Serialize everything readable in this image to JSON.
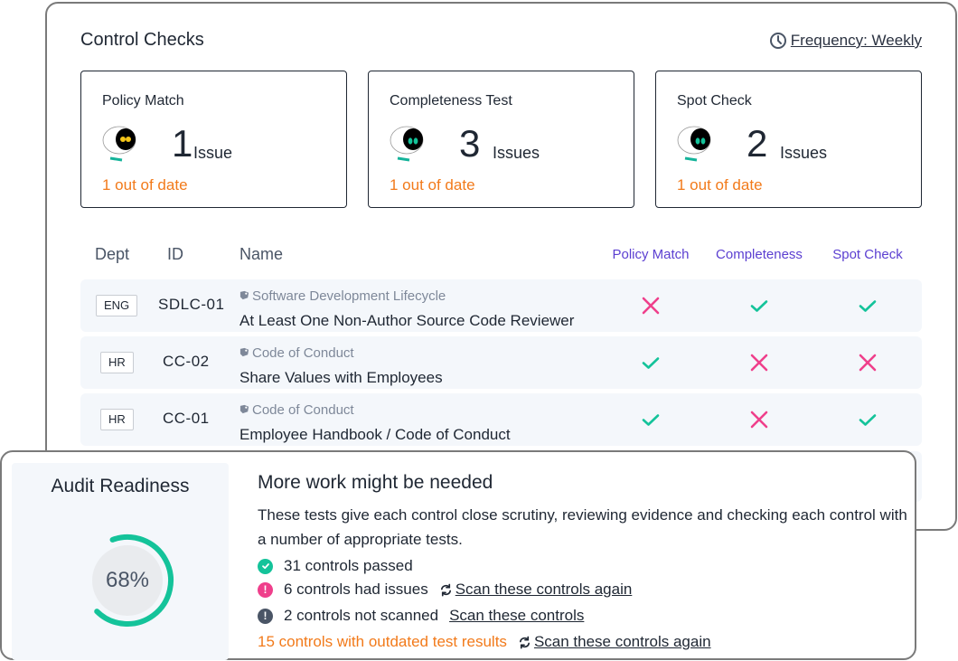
{
  "colors": {
    "accent_purple": "#5b3fd1",
    "pass_green": "#14c39a",
    "fail_pink": "#ef3f8b",
    "warn_orange": "#f27a1a",
    "neutral_slate": "#4a5566"
  },
  "control_checks": {
    "title": "Control Checks",
    "frequency": {
      "icon": "clock-icon",
      "label": "Frequency: Weekly"
    },
    "cards": [
      {
        "title": "Policy Match",
        "count": "1",
        "unit": "Issue",
        "out_of_date": "1 out of date",
        "eye_color": "yellow"
      },
      {
        "title": "Completeness Test",
        "count": "3",
        "unit": "Issues",
        "out_of_date": "1 out of date",
        "eye_color": "teal"
      },
      {
        "title": "Spot Check",
        "count": "2",
        "unit": "Issues",
        "out_of_date": "1 out of date",
        "eye_color": "teal"
      }
    ],
    "table": {
      "headers": {
        "dept": "Dept",
        "id": "ID",
        "name": "Name",
        "policy": "Policy Match",
        "completeness": "Completeness",
        "spot": "Spot Check"
      },
      "rows": [
        {
          "dept": "ENG",
          "id": "SDLC-01",
          "category": "Software Development Lifecycle",
          "name": "At Least One Non-Author Source Code Reviewer",
          "policy": "fail",
          "completeness": "pass",
          "spot": "pass"
        },
        {
          "dept": "HR",
          "id": "CC-02",
          "category": "Code of Conduct",
          "name": "Share Values with Employees",
          "policy": "pass",
          "completeness": "fail",
          "spot": "fail"
        },
        {
          "dept": "HR",
          "id": "CC-01",
          "category": "Code of Conduct",
          "name": "Employee Handbook / Code of Conduct",
          "policy": "pass",
          "completeness": "fail",
          "spot": "pass"
        }
      ]
    }
  },
  "audit": {
    "title": "Audit Readiness",
    "percent": 68,
    "percent_label": "68%",
    "heading": "More work might be needed",
    "description": "These tests give each control close scrutiny, reviewing evidence and checking each control with a number of appropriate tests.",
    "passed": "31 controls passed",
    "issues": "6 controls had issues",
    "issues_link": "Scan these controls again",
    "not_scanned": "2 controls not scanned",
    "not_scanned_link": "Scan these controls",
    "outdated": "15 controls with outdated test results",
    "outdated_link": "Scan these controls again"
  }
}
